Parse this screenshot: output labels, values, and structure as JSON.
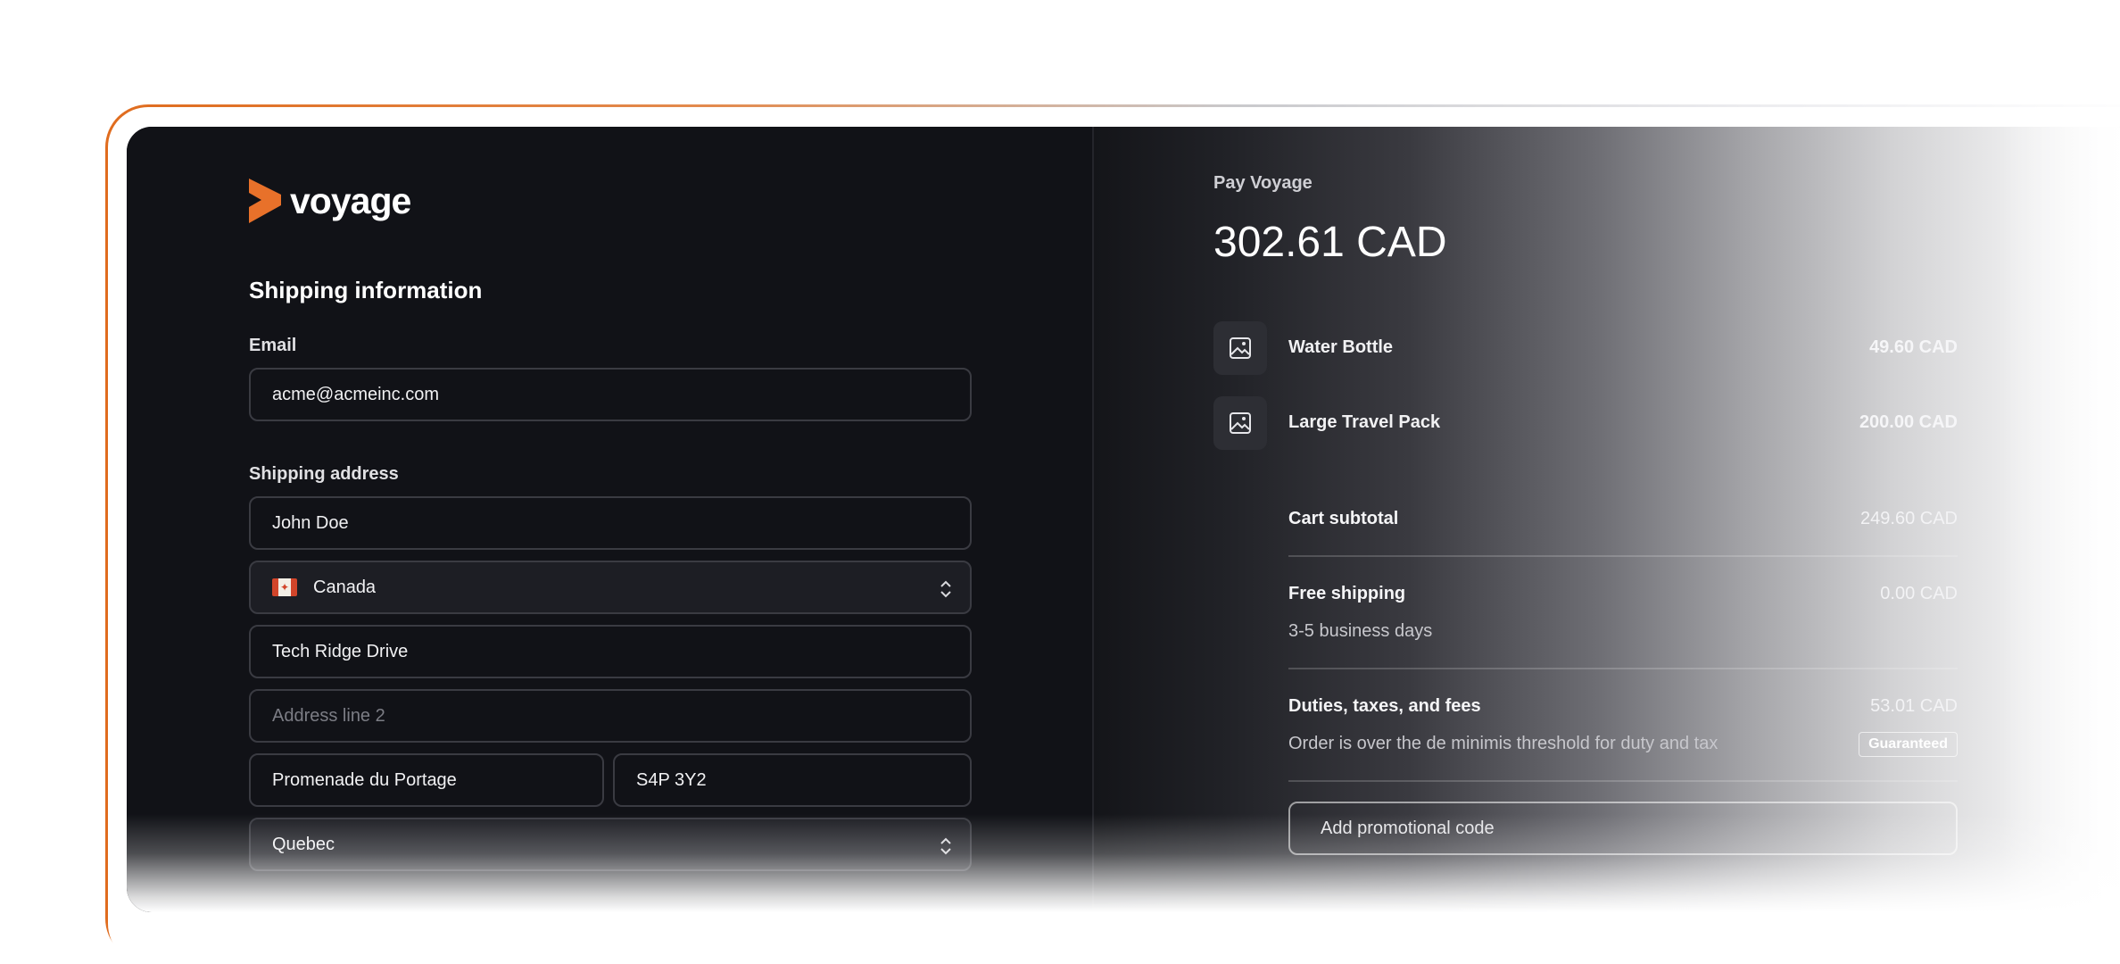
{
  "brand": {
    "name": "voyage",
    "accent": "#e8712a"
  },
  "shipping": {
    "heading": "Shipping information",
    "email_label": "Email",
    "email_value": "acme@acmeinc.com",
    "address_label": "Shipping address",
    "name_value": "John Doe",
    "country_value": "Canada",
    "address1_value": "Tech Ridge Drive",
    "address2_placeholder": "Address line 2",
    "city_value": "Promenade du Portage",
    "postal_value": "S4P 3Y2",
    "province_value": "Quebec"
  },
  "summary": {
    "pay_label": "Pay Voyage",
    "total": "302.61 CAD",
    "items": [
      {
        "name": "Water Bottle",
        "price": "49.60 CAD",
        "icon": "image-icon"
      },
      {
        "name": "Large Travel Pack",
        "price": "200.00 CAD",
        "icon": "image-icon"
      }
    ],
    "subtotal_label": "Cart subtotal",
    "subtotal_value": "249.60 CAD",
    "shipping_label": "Free shipping",
    "shipping_value": "0.00 CAD",
    "shipping_note": "3-5 business days",
    "taxes_label": "Duties, taxes, and fees",
    "taxes_value": "53.01 CAD",
    "taxes_note": "Order is over the de minimis threshold for duty and tax",
    "taxes_badge": "Guaranteed",
    "promo_placeholder": "Add promotional code"
  }
}
